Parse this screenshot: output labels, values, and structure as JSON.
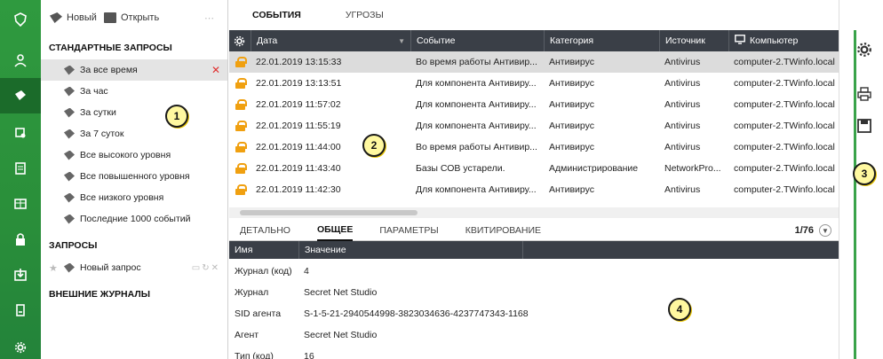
{
  "rail": {
    "icons": [
      "shield-icon",
      "users-icon",
      "events-icon",
      "computer-icon",
      "list-icon",
      "grid-icon",
      "lock-icon",
      "download-icon",
      "alert-icon",
      "gear-icon"
    ]
  },
  "query_panel": {
    "toolbar": {
      "new_label": "Новый",
      "open_label": "Открыть"
    },
    "standard_header": "СТАНДАРТНЫЕ ЗАПРОСЫ",
    "standard_items": [
      "За все время",
      "За час",
      "За сутки",
      "За 7 суток",
      "Все высокого уровня",
      "Все повышенного уровня",
      "Все низкого уровня",
      "Последние 1000 событий"
    ],
    "queries_header": "ЗАПРОСЫ",
    "new_query": "Новый запрос",
    "external_header": "ВНЕШНИЕ ЖУРНАЛЫ"
  },
  "callouts": [
    "1",
    "2",
    "3",
    "4"
  ],
  "main": {
    "tabs": [
      "СОБЫТИЯ",
      "УГРОЗЫ"
    ],
    "columns": [
      "Дата",
      "Событие",
      "Категория",
      "Источник",
      "Компьютер"
    ],
    "rows": [
      [
        "22.01.2019 13:15:33",
        "Во время работы Антивир...",
        "Антивирус",
        "Antivirus",
        "computer-2.TWinfo.local"
      ],
      [
        "22.01.2019 13:13:51",
        "Для компонента Антивиру...",
        "Антивирус",
        "Antivirus",
        "computer-2.TWinfo.local"
      ],
      [
        "22.01.2019 11:57:02",
        "Для компонента Антивиру...",
        "Антивирус",
        "Antivirus",
        "computer-2.TWinfo.local"
      ],
      [
        "22.01.2019 11:55:19",
        "Для компонента Антивиру...",
        "Антивирус",
        "Antivirus",
        "computer-2.TWinfo.local"
      ],
      [
        "22.01.2019 11:44:00",
        "Во время работы Антивир...",
        "Антивирус",
        "Antivirus",
        "computer-2.TWinfo.local"
      ],
      [
        "22.01.2019 11:43:40",
        "Базы СОВ устарели.",
        "Администрирование",
        "NetworkPro...",
        "computer-2.TWinfo.local"
      ],
      [
        "22.01.2019 11:42:30",
        "Для компонента Антивиру...",
        "Антивирус",
        "Antivirus",
        "computer-2.TWinfo.local"
      ]
    ],
    "detail_tabs": [
      "ДЕТАЛЬНО",
      "ОБЩЕЕ",
      "ПАРАМЕТРЫ",
      "КВИТИРОВАНИЕ"
    ],
    "pager": "1/76",
    "detail_columns": [
      "Имя",
      "Значение"
    ],
    "detail_rows": [
      [
        "Журнал (код)",
        "4"
      ],
      [
        "Журнал",
        "Secret Net Studio"
      ],
      [
        "SID агента",
        "S-1-5-21-2940544998-3823034636-4237747343-1168"
      ],
      [
        "Агент",
        "Secret Net Studio"
      ],
      [
        "Тип (код)",
        "16"
      ]
    ]
  },
  "right_panel": {
    "icons": [
      "settings-icon",
      "print-icon",
      "save-icon"
    ]
  },
  "colors": {
    "accent": "#2f9a3f",
    "header": "#3a3f47",
    "lock": "#f0a010",
    "badge": "#fff8a0"
  }
}
